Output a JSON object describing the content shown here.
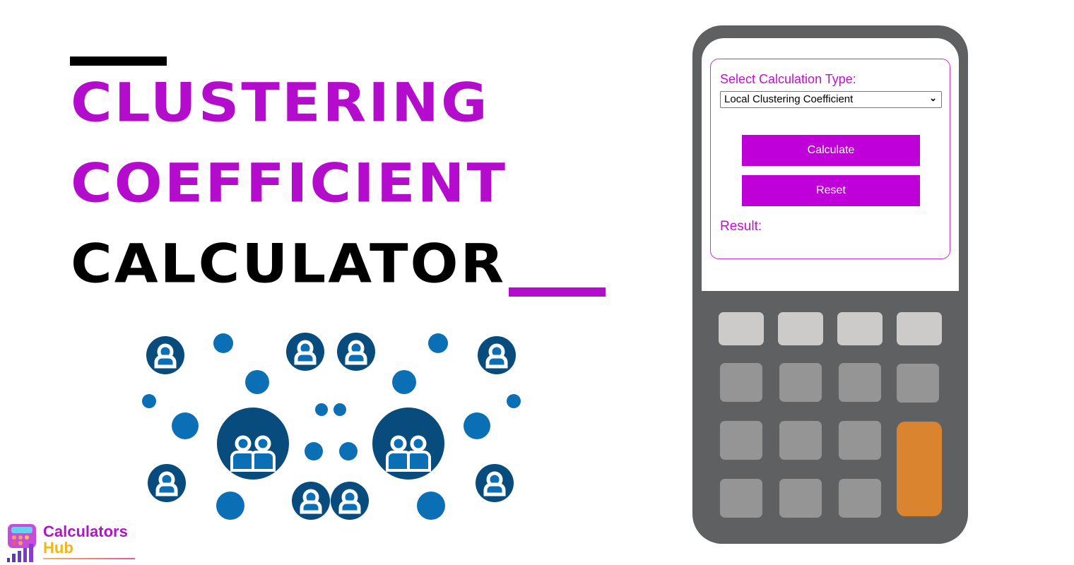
{
  "title": {
    "line1": "CLUSTERING",
    "line2": "COEFFICIENT",
    "line3": "CALCULATOR"
  },
  "colors": {
    "accent": "#b40ccd",
    "button": "#c000d8",
    "calculator_body": "#5f6062",
    "key_light": "#cccbc9",
    "key_mid": "#959595",
    "key_orange": "#db8430",
    "illustration_dark": "#074c7c",
    "illustration_light": "#0a6fb4"
  },
  "calculator": {
    "select_label": "Select Calculation Type:",
    "select_value": "Local Clustering Coefficient",
    "calculate_label": "Calculate",
    "reset_label": "Reset",
    "result_label": "Result:"
  },
  "logo": {
    "word1": "Calculators",
    "word2": "Hub"
  }
}
